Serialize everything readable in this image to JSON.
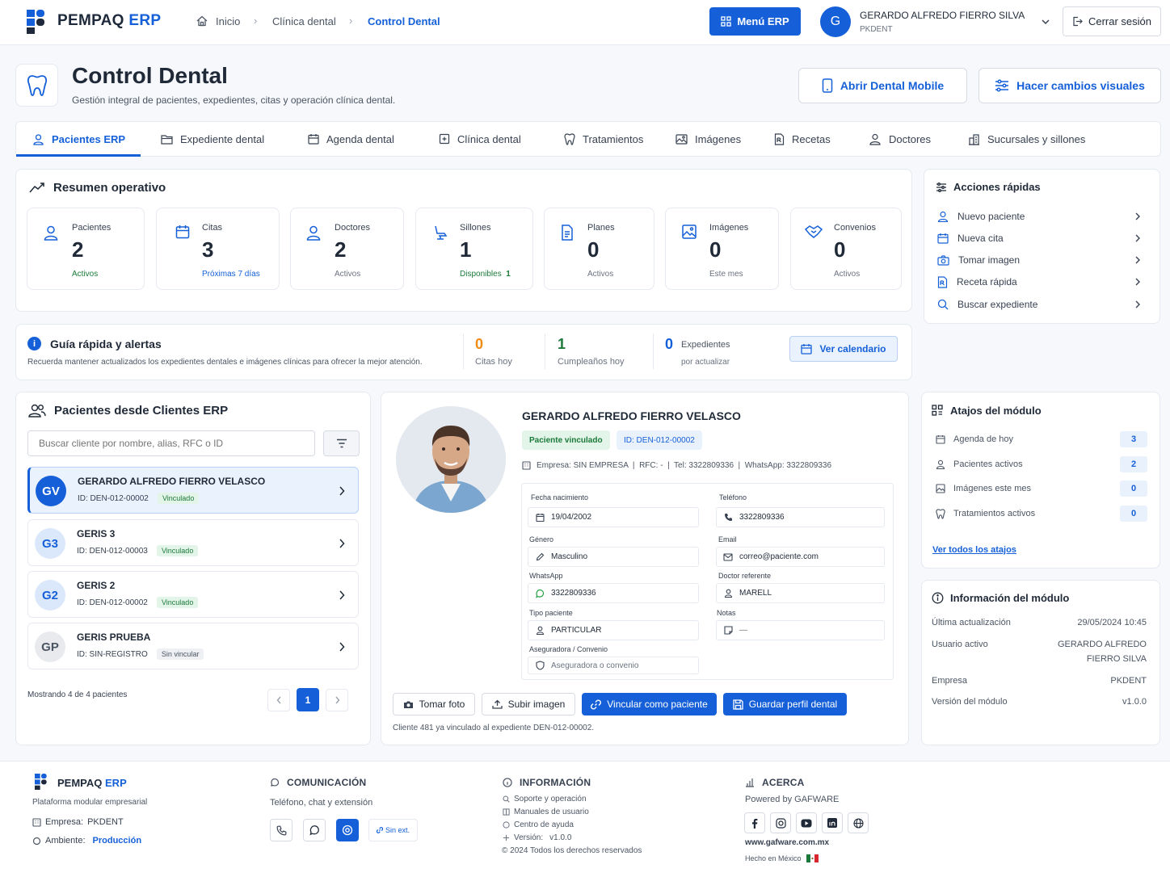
{
  "colors": {
    "accent": "#1560d8",
    "green": "#1b7a3a",
    "orange": "#ef8a13"
  },
  "topbar": {
    "brand": "PEMPAQ",
    "brand_accent": "ERP",
    "breadcrumb": [
      "Inicio",
      "Clínica dental",
      "Control Dental"
    ],
    "menu_button": "Menú ERP",
    "user_initial": "G",
    "user_name": "GERARDO ALFREDO FIERRO SILVA",
    "user_company": "PKDENT",
    "logout": "Cerrar sesión"
  },
  "header": {
    "title": "Control Dental",
    "subtitle": "Gestión integral de pacientes, expedientes, citas y operación clínica dental.",
    "mobile_button": "Abrir Dental Mobile",
    "visual_button": "Hacer cambios visuales"
  },
  "tabs": [
    "Pacientes ERP",
    "Expediente dental",
    "Agenda dental",
    "Clínica dental",
    "Tratamientos",
    "Imágenes",
    "Recetas",
    "Doctores",
    "Sucursales y sillones"
  ],
  "summary": {
    "title": "Resumen operativo",
    "stats": [
      {
        "label": "Pacientes",
        "value": "2",
        "sub": "Activos"
      },
      {
        "label": "Citas",
        "value": "3",
        "sub": "Próximas 7 días"
      },
      {
        "label": "Doctores",
        "value": "2",
        "sub": "Activos"
      },
      {
        "label": "Sillones",
        "value": "1",
        "sub": "Disponibles",
        "sub_count": "1"
      },
      {
        "label": "Planes",
        "value": "0",
        "sub": "Activos"
      },
      {
        "label": "Imágenes",
        "value": "0",
        "sub": "Este mes"
      },
      {
        "label": "Convenios",
        "value": "0",
        "sub": "Activos"
      }
    ]
  },
  "quick_actions": {
    "title": "Acciones rápidas",
    "items": [
      "Nuevo paciente",
      "Nueva cita",
      "Tomar imagen",
      "Receta rápida",
      "Buscar expediente"
    ]
  },
  "guide": {
    "title": "Guía rápida y alertas",
    "text": "Recuerda mantener actualizados los expedientes dentales e imágenes clínicas para ofrecer la mejor atención.",
    "citas_value": "0",
    "citas_label": "Citas hoy",
    "cumple_value": "1",
    "cumple_label": "Cumpleaños hoy",
    "exp_value": "0",
    "exp_label1": "Expedientes",
    "exp_label2": "por actualizar",
    "calendar_button": "Ver calendario"
  },
  "patients": {
    "title": "Pacientes desde Clientes ERP",
    "search_placeholder": "Buscar cliente por nombre, alias, RFC o ID",
    "list": [
      {
        "initials": "GV",
        "name": "GERARDO ALFREDO FIERRO VELASCO",
        "id": "ID: DEN-012-00002",
        "status": "Vinculado"
      },
      {
        "initials": "G3",
        "name": "GERIS 3",
        "id": "ID: DEN-012-00003",
        "status": "Vinculado"
      },
      {
        "initials": "G2",
        "name": "GERIS 2",
        "id": "ID: DEN-012-00002",
        "status": "Vinculado"
      },
      {
        "initials": "GP",
        "name": "GERIS PRUEBA",
        "id": "ID: SIN-REGISTRO",
        "status": "Sin vincular"
      }
    ],
    "showing": "Mostrando 4 de 4 pacientes",
    "page": "1"
  },
  "profile": {
    "name": "GERARDO ALFREDO FIERRO VELASCO",
    "badge_linked": "Paciente vinculado",
    "badge_id": "ID: DEN-012-00002",
    "meta": "Empresa: SIN EMPRESA  |  RFC: -  |  Tel: 3322809336  |  WhatsApp: 3322809336",
    "fields": {
      "birth_label": "Fecha nacimiento",
      "birth": "19/04/2002",
      "phone_label": "Teléfono",
      "phone": "3322809336",
      "gender_label": "Género",
      "gender": "Masculino",
      "email_label": "Email",
      "email": "correo@paciente.com",
      "whatsapp_label": "WhatsApp",
      "whatsapp": "3322809336",
      "doctor_label": "Doctor referente",
      "doctor": "MARELL",
      "type_label": "Tipo paciente",
      "type": "PARTICULAR",
      "notes_label": "Notas",
      "notes": "—",
      "insurer_label": "Aseguradora / Convenio",
      "insurer": "Aseguradora o convenio"
    },
    "buttons": {
      "photo": "Tomar foto",
      "upload": "Subir imagen",
      "link": "Vincular como paciente",
      "save": "Guardar perfil dental"
    },
    "footnote": "Cliente 481 ya vinculado al expediente DEN-012-00002."
  },
  "shortcuts": {
    "title": "Atajos del módulo",
    "items": [
      {
        "label": "Agenda de hoy",
        "count": "3"
      },
      {
        "label": "Pacientes activos",
        "count": "2"
      },
      {
        "label": "Imágenes este mes",
        "count": "0"
      },
      {
        "label": "Tratamientos activos",
        "count": "0"
      }
    ],
    "link": "Ver todos los atajos"
  },
  "module_info": {
    "title": "Información del módulo",
    "updated_label": "Última actualización",
    "updated": "29/05/2024 10:45",
    "user_label": "Usuario activo",
    "user_line1": "GERARDO ALFREDO",
    "user_line2": "FIERRO SILVA",
    "company_label": "Empresa",
    "company": "PKDENT",
    "version_label": "Versión del módulo",
    "version": "v1.0.0"
  },
  "footer": {
    "brand": "PEMPAQ",
    "brand_accent": "ERP",
    "tagline": "Plataforma modular empresarial",
    "company_label": "Empresa:",
    "company": "PKDENT",
    "env_label": "Ambiente:",
    "env": "Producción",
    "comm_title": "COMUNICACIÓN",
    "comm_text": "Teléfono, chat y extensión",
    "no_ext": "Sin ext.",
    "info_title": "INFORMACIÓN",
    "info_items": [
      "Soporte y operación",
      "Manuales de usuario",
      "Centro de ayuda"
    ],
    "version_label": "Versión:",
    "version": "v1.0.0",
    "copyright": "© 2024 Todos los derechos reservados",
    "about_title": "ACERCA",
    "powered": "Powered by GAFWARE",
    "site": "www.gafware.com.mx",
    "made_in": "Hecho en México"
  }
}
